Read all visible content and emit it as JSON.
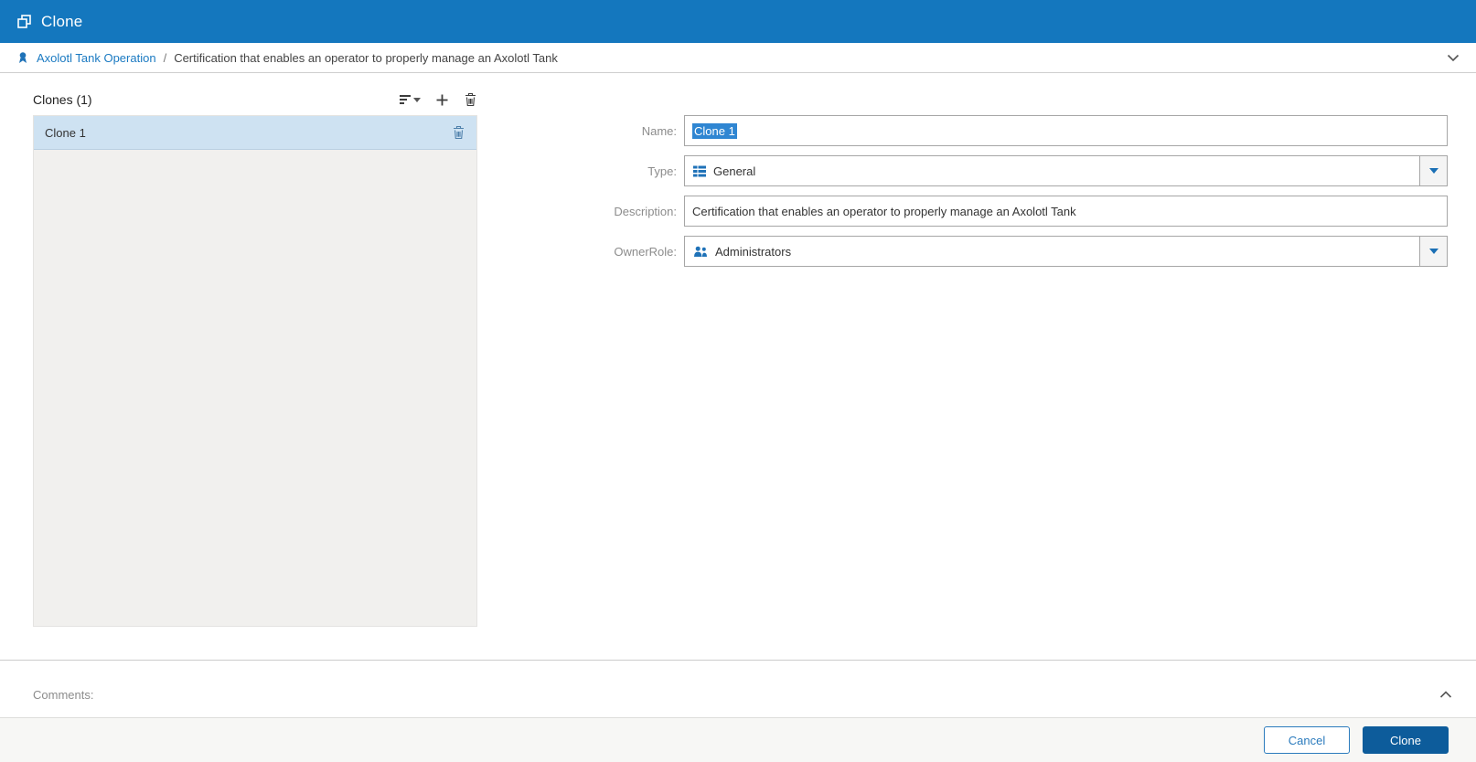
{
  "titlebar": {
    "title": "Clone"
  },
  "breadcrumb": {
    "root": "Axolotl Tank Operation",
    "separator": "/",
    "current": "Certification that enables an operator to properly manage an Axolotl Tank"
  },
  "clones_panel": {
    "header": "Clones (1)",
    "items": [
      {
        "label": "Clone 1"
      }
    ]
  },
  "form": {
    "name": {
      "label": "Name:",
      "value": "Clone 1"
    },
    "type": {
      "label": "Type:",
      "value": "General"
    },
    "description": {
      "label": "Description:",
      "value": "Certification that enables an operator to properly manage an Axolotl Tank"
    },
    "owner_role": {
      "label": "OwnerRole:",
      "value": "Administrators"
    }
  },
  "comments": {
    "label": "Comments:"
  },
  "footer": {
    "cancel_label": "Cancel",
    "clone_label": "Clone"
  },
  "icons": {
    "titlebar_icon": "clone-overlapping-squares",
    "breadcrumb_icon": "certification-ribbon",
    "toolbar_icons": [
      "sort-icon",
      "add-icon",
      "trash-icon"
    ],
    "type_field_icon": "table-grid",
    "owner_field_icon": "people-group",
    "combo_caret": "caret-down",
    "breadcrumb_right_icon": "chevron-down",
    "comments_icon": "chevron-up"
  },
  "colors": {
    "topbar_blue": "#1477BE",
    "link_blue": "#1B7AC2",
    "selected_row": "#CEE2F2",
    "text_selection": "#2F86D2",
    "primary_button": "#0D5C9B",
    "secondary_button_border": "#2B7BBD",
    "field_icon_blue": "#1F72B8"
  }
}
